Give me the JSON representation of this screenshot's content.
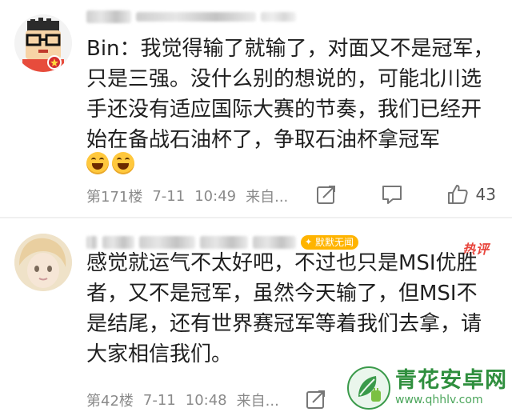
{
  "comments": [
    {
      "username_blurred": true,
      "text": "Bin：我觉得输了就输了，对面又不是冠军，只是三强。没什么别的想说的，可能北川选手还没有适应国际大赛的节奏，我们已经开始在备战石油杯了，争取石油杯拿冠军",
      "emojis": [
        "grin-emoji",
        "grin-emoji"
      ],
      "floor": "第171楼",
      "date": "7-11",
      "time": "10:49",
      "source": "来自...",
      "likes": "43"
    },
    {
      "username_blurred": true,
      "badge": "默默无闻",
      "hot_tag": "热评",
      "text": "感觉就运气不太好吧，不过也只是MSI优胜者，又不是冠军，虽然今天输了，但MSI不是结尾，还有世界赛冠军等着我们去拿，请大家相信我们。",
      "floor": "第42楼",
      "date": "7-11",
      "time": "10:48",
      "source": "来自..."
    }
  ],
  "watermark": {
    "title": "青花安卓网",
    "url": "www.qhhlv.com"
  },
  "colors": {
    "meta_gray": "#8a8a8a",
    "hot_red": "#e8453c",
    "badge_orange": "#ffb400",
    "watermark_green": "#2f8f3e"
  }
}
